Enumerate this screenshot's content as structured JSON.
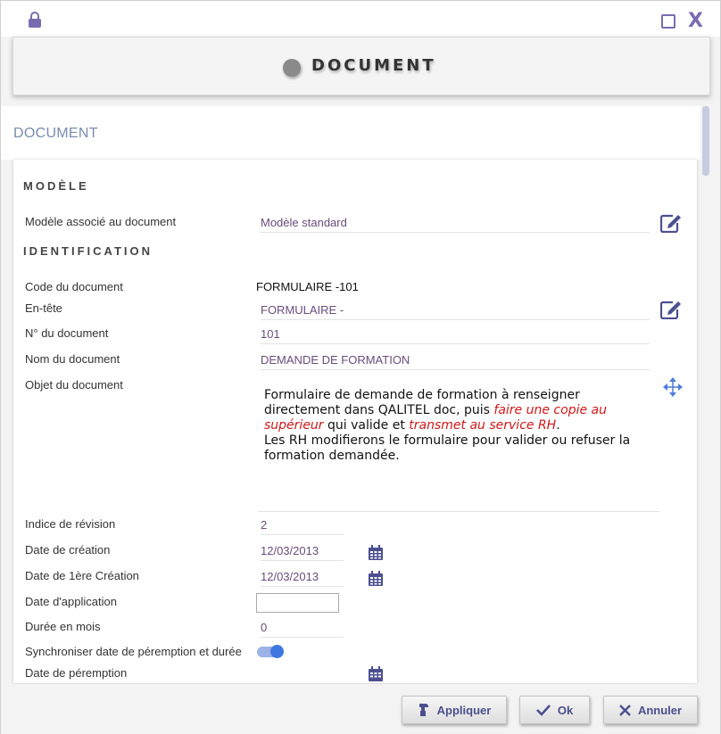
{
  "window": {
    "title": "DOCUMENT",
    "breadcrumb": "DOCUMENT"
  },
  "sections": {
    "modele": "MODÈLE",
    "identification": "IDENTIFICATION"
  },
  "fields": {
    "modele_associe": {
      "label": "Modèle associé au document",
      "value": "Modèle standard"
    },
    "code": {
      "label": "Code du document",
      "value": "FORMULAIRE -101"
    },
    "entete": {
      "label": "En-tête",
      "value": "FORMULAIRE -"
    },
    "numero": {
      "label": "N° du document",
      "value": "101"
    },
    "nom": {
      "label": "Nom du document",
      "value": "DEMANDE DE FORMATION"
    },
    "objet": {
      "label": "Objet du document",
      "text_1": "Formulaire de demande de formation à renseigner directement dans QALITEL doc, puis ",
      "text_red_1": "faire une copie au supérieur",
      "text_2": " qui valide et ",
      "text_red_2": "transmet au service RH",
      "text_3": ".",
      "text_4": "Les RH modifierons le formulaire pour valider ou refuser la formation demandée."
    },
    "indice": {
      "label": "Indice de révision",
      "value": "2"
    },
    "date_creation": {
      "label": "Date de création",
      "value": "12/03/2013"
    },
    "date_1ere_creation": {
      "label": "Date de 1ère Création",
      "value": "12/03/2013"
    },
    "date_application": {
      "label": "Date d'application",
      "value": ""
    },
    "duree": {
      "label": "Durée en mois",
      "value": "0"
    },
    "synchroniser": {
      "label": "Synchroniser date de péremption et durée",
      "checked": true
    },
    "date_peremption": {
      "label": "Date de péremption",
      "value": ""
    }
  },
  "buttons": {
    "appliquer": "Appliquer",
    "ok": "Ok",
    "annuler": "Annuler"
  },
  "colors": {
    "accent": "#7a6bb0",
    "value_text": "#6a4c7c",
    "button_text": "#4a4f8c",
    "red_text": "#d01818",
    "toggle_on": "#3f77e0"
  },
  "icons": [
    "lock-icon",
    "maximize-icon",
    "close-icon",
    "edit-icon",
    "move-icon",
    "calendar-icon",
    "stamp-icon",
    "check-icon",
    "x-icon"
  ]
}
